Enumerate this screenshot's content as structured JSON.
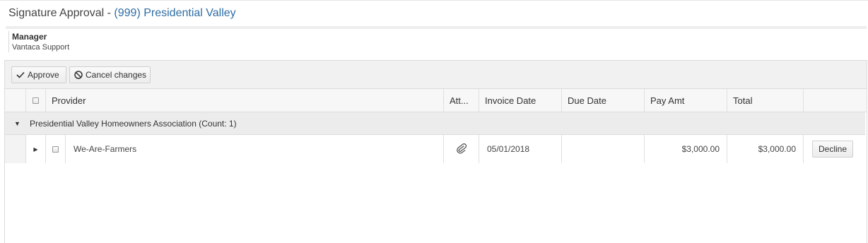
{
  "header": {
    "title_prefix": "Signature Approval - ",
    "community": "(999) Presidential Valley"
  },
  "approver": {
    "label": "Manager",
    "name": "Vantaca Support"
  },
  "toolbar": {
    "approve_label": "Approve",
    "cancel_label": "Cancel changes"
  },
  "grid": {
    "columns": [
      "Provider",
      "Att...",
      "Invoice Date",
      "Due Date",
      "Pay Amt",
      "Total"
    ],
    "group": {
      "label": "Presidential Valley Homeowners Association (Count: 1)"
    },
    "rows": [
      {
        "provider": "We-Are-Farmers",
        "attachment_icon": "paperclip-icon",
        "invoice_date": "05/01/2018",
        "due_date": "",
        "pay_amt": "$3,000.00",
        "total": "$3,000.00",
        "action_label": "Decline"
      }
    ]
  },
  "colors": {
    "link": "#2e6da4",
    "header_bg": "#f7f7f7",
    "group_bg": "#ececec"
  }
}
